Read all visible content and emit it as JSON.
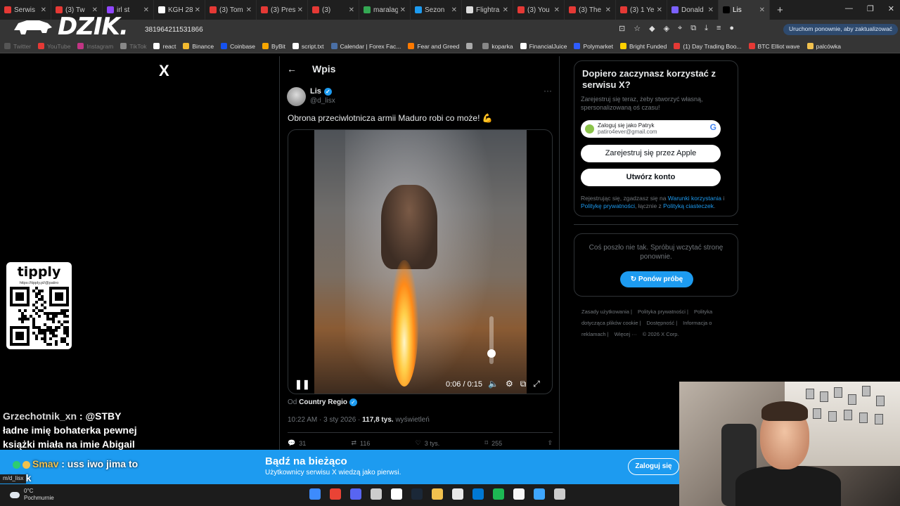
{
  "browser": {
    "tabs": [
      {
        "label": "Serwis",
        "color": "#e53935",
        "active": false
      },
      {
        "label": "(3) Tw",
        "color": "#e53935",
        "active": false
      },
      {
        "label": "irl st",
        "color": "#9146ff",
        "active": false
      },
      {
        "label": "KGH 28",
        "color": "#ffffff",
        "active": false
      },
      {
        "label": "(3) Tom",
        "color": "#e53935",
        "active": false
      },
      {
        "label": "(3) Pres",
        "color": "#e53935",
        "active": false
      },
      {
        "label": "(3)",
        "color": "#e53935",
        "active": false
      },
      {
        "label": "maralag",
        "color": "#34a853",
        "active": false
      },
      {
        "label": "Sezon",
        "color": "#1d9bf0",
        "active": false
      },
      {
        "label": "Flightra",
        "color": "#dddddd",
        "active": false
      },
      {
        "label": "(3) You",
        "color": "#e53935",
        "active": false
      },
      {
        "label": "(3) The",
        "color": "#e53935",
        "active": false
      },
      {
        "label": "(3) 1 Ye",
        "color": "#e53935",
        "active": false
      },
      {
        "label": "Donald",
        "color": "#7b61ff",
        "active": false
      },
      {
        "label": "Lis",
        "color": "#000000",
        "active": true
      }
    ],
    "new_tab": "+",
    "url": "381964211531866",
    "update_button": "Uruchom ponownie, aby zaktualizować",
    "bookmarks": [
      {
        "label": "Twitter",
        "color": "#555",
        "dim": true
      },
      {
        "label": "YouTube",
        "color": "#e53935",
        "dim": true
      },
      {
        "label": "Instagram",
        "color": "#c13584",
        "dim": true
      },
      {
        "label": "TikTok",
        "color": "#888",
        "dim": true
      },
      {
        "label": "react",
        "color": "#fff",
        "dim": false
      },
      {
        "label": "Binance",
        "color": "#f3ba2f",
        "dim": false
      },
      {
        "label": "Coinbase",
        "color": "#1652f0",
        "dim": false
      },
      {
        "label": "ByBit",
        "color": "#f7a600",
        "dim": false
      },
      {
        "label": "script.txt",
        "color": "#fff",
        "dim": false
      },
      {
        "label": "Calendar | Forex Fac...",
        "color": "#4a6fa5",
        "dim": false
      },
      {
        "label": "Fear and Greed",
        "color": "#ff7a00",
        "dim": false
      },
      {
        "label": "",
        "color": "#aaa",
        "dim": false
      },
      {
        "label": "koparka",
        "color": "#888",
        "dim": false
      },
      {
        "label": "FinancialJuice",
        "color": "#fff",
        "dim": false
      },
      {
        "label": "Polymarket",
        "color": "#2e5cff",
        "dim": false
      },
      {
        "label": "Bright Funded",
        "color": "#ffd000",
        "dim": false
      },
      {
        "label": "(1) Day Trading Boo...",
        "color": "#e53935",
        "dim": false
      },
      {
        "label": "BTC Elliot wave",
        "color": "#e53935",
        "dim": false
      },
      {
        "label": "palcówka",
        "color": "#f2c14e",
        "dim": false
      }
    ]
  },
  "overlay": {
    "logo": "DZIK."
  },
  "x": {
    "logo": "X",
    "header_back": "←",
    "header_title": "Wpis",
    "author_name": "Lis",
    "author_handle": "@d_lisx",
    "more": "···",
    "post_text": "Obrona przeciwlotnicza armii Maduro robi co może! 💪",
    "video": {
      "time": "0:06 / 0:15",
      "progress": 0.4,
      "volume": 0.3,
      "watermark": "──•──"
    },
    "source_prefix": "Od",
    "source_name": "Country Regio",
    "timestamp": "10:22 AM · 3 sty 2026 · ",
    "views": "117,8 tys.",
    "views_label": "wyświetleń",
    "actions": {
      "replies": "31",
      "reposts": "116",
      "likes": "3 tys.",
      "bookmarks": "255"
    }
  },
  "sidebar": {
    "title": "Dopiero zaczynasz korzystać z serwisu X?",
    "subtitle": "Zarejestruj się teraz, żeby stworzyć własną, spersonalizowaną oś czasu!",
    "google_line1": "Zaloguj się jako Patryk",
    "google_line2": "patiro4ever@gmail.com",
    "google_logo": "G",
    "apple_button": "Zarejestruj się przez Apple",
    "create_button": "Utwórz konto",
    "legal_text": "Rejestrując się, zgadzasz się na ",
    "legal_link1": "Warunki korzystania",
    "legal_text2": " i ",
    "legal_link2": "Politykę prywatności",
    "legal_text3": ", łącznie z ",
    "legal_link3": "Polityką ciasteczek",
    "legal_text4": ".",
    "error_text": "Coś poszło nie tak. Spróbuj wczytać stronę ponownie.",
    "retry_button": "Ponów próbę",
    "footer": [
      "Zasady użytkowania |",
      "Polityka prywatności |",
      "Polityka dotycząca plików cookie |",
      "Dostępność |",
      "Informacja o reklamach |",
      "Więcej ···",
      "© 2026 X Corp."
    ]
  },
  "tipply": {
    "logo": "tipply",
    "url": "https://tipply.pl/@patiro"
  },
  "chat": {
    "msg1_user": "Grzechotnik_xn",
    "msg1_text": " : @STBY ładne imię bohaterka pewnej książki miała na imie Abigail",
    "msg2_user": "Smav",
    "msg2_text": " : uss iwo jima to statek"
  },
  "banner": {
    "title": "Bądź na bieżąco",
    "subtitle": "Użytkownicy serwisu X wiedzą jako pierwsi.",
    "login_button": "Zaloguj się",
    "status_url": "m/d_lisx"
  },
  "taskbar": {
    "temp": "0°C",
    "weather": "Pochmurnie",
    "apps": [
      "#3d8bfd",
      "#ea4335",
      "#5865f2",
      "#cccccc",
      "#ffffff",
      "#1b2838",
      "#f2c14e",
      "#e8e8e8",
      "#0078d4",
      "#1db954",
      "#f7f7f7",
      "#3ea6ff",
      "#cccccc"
    ]
  }
}
